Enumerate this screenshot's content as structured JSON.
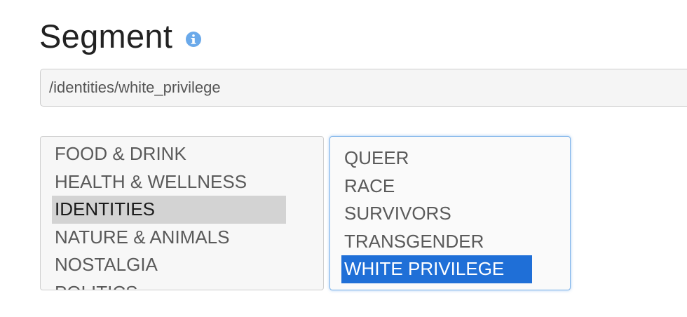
{
  "segment": {
    "title": "Segment",
    "info_icon": "info-circle-icon",
    "path_value": "/identities/white_privilege"
  },
  "categories": {
    "items": [
      {
        "label": "FOOD & DRINK",
        "selected": false
      },
      {
        "label": "HEALTH & WELLNESS",
        "selected": false
      },
      {
        "label": "IDENTITIES",
        "selected": true
      },
      {
        "label": "NATURE & ANIMALS",
        "selected": false
      },
      {
        "label": "NOSTALGIA",
        "selected": false
      },
      {
        "label": "POLITICS",
        "selected": false
      }
    ]
  },
  "subcategories": {
    "items": [
      {
        "label": "QUEER",
        "selected": false
      },
      {
        "label": "RACE",
        "selected": false
      },
      {
        "label": "SURVIVORS",
        "selected": false
      },
      {
        "label": "TRANSGENDER",
        "selected": false
      },
      {
        "label": "WHITE PRIVILEGE",
        "selected": true
      }
    ]
  },
  "colors": {
    "selected_focused": "#1f6fd7",
    "selected_unfocused": "#d3d3d3",
    "info_icon": "#6aa9ea",
    "focus_border": "#7fb4ea"
  }
}
